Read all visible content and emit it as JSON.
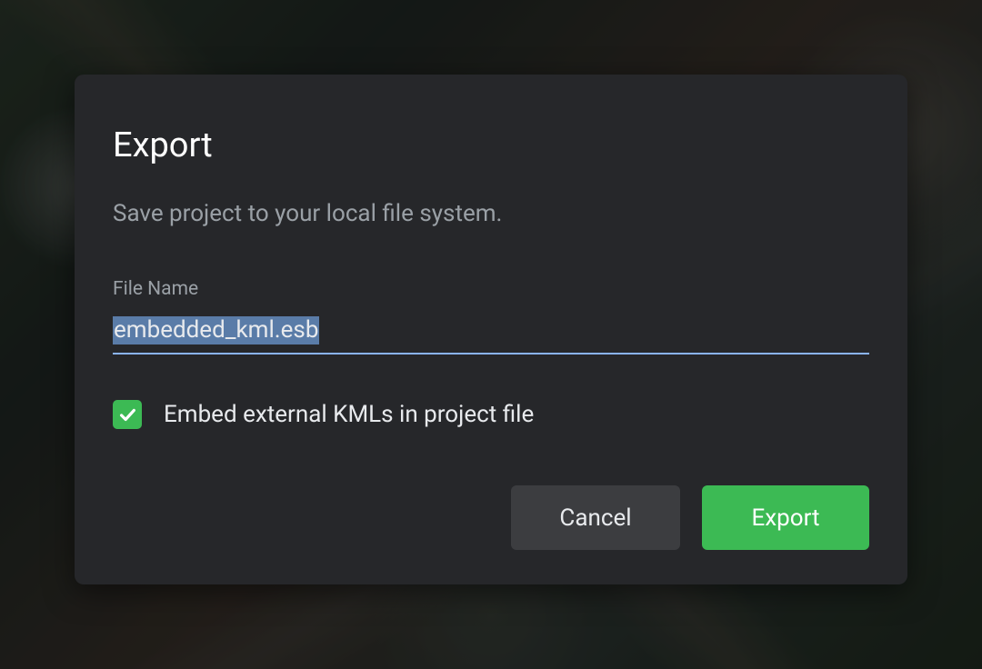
{
  "dialog": {
    "title": "Export",
    "subtitle": "Save project to your local file system.",
    "fileNameLabel": "File Name",
    "fileNameValue": "embedded_kml.esb",
    "checkboxLabel": "Embed external KMLs in project file",
    "checkboxChecked": true,
    "buttons": {
      "cancel": "Cancel",
      "export": "Export"
    }
  },
  "colors": {
    "dialogBg": "#26272a",
    "accent": "#3cba54",
    "inputUnderline": "#8ab4f8",
    "textPrimary": "#ffffff",
    "textSecondary": "#9aa0a6",
    "textBody": "#e8eaed"
  }
}
